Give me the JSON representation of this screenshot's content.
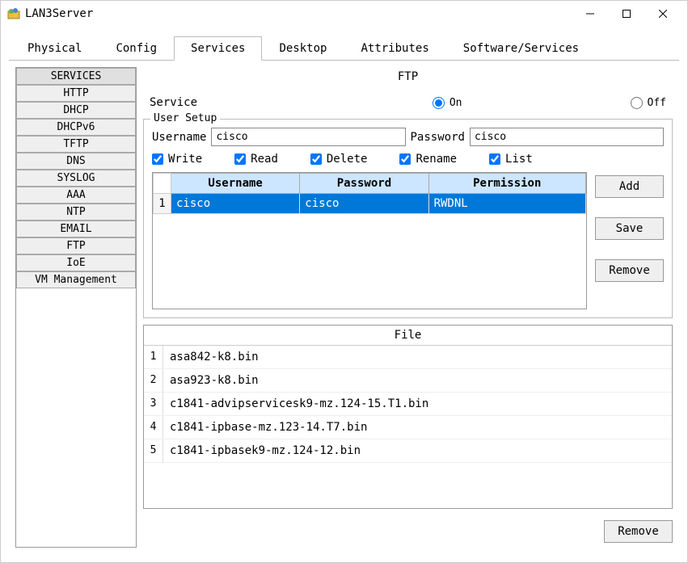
{
  "window": {
    "title": "LAN3Server"
  },
  "tabs": [
    {
      "label": "Physical"
    },
    {
      "label": "Config"
    },
    {
      "label": "Services"
    },
    {
      "label": "Desktop"
    },
    {
      "label": "Attributes"
    },
    {
      "label": "Software/Services"
    }
  ],
  "active_tab": 2,
  "sidebar": {
    "header": "SERVICES",
    "items": [
      "HTTP",
      "DHCP",
      "DHCPv6",
      "TFTP",
      "DNS",
      "SYSLOG",
      "AAA",
      "NTP",
      "EMAIL",
      "FTP",
      "IoE",
      "VM Management"
    ]
  },
  "panel": {
    "title": "FTP",
    "service_label": "Service",
    "on_label": "On",
    "off_label": "Off",
    "service_on": true
  },
  "user_setup": {
    "legend": "User Setup",
    "username_label": "Username",
    "username_value": "cisco",
    "password_label": "Password",
    "password_value": "cisco",
    "perms": {
      "write": {
        "label": "Write",
        "checked": true
      },
      "read": {
        "label": "Read",
        "checked": true
      },
      "delete": {
        "label": "Delete",
        "checked": true
      },
      "rename": {
        "label": "Rename",
        "checked": true
      },
      "list": {
        "label": "List",
        "checked": true
      }
    },
    "table": {
      "headers": {
        "username": "Username",
        "password": "Password",
        "permission": "Permission"
      },
      "rows": [
        {
          "num": "1",
          "username": "cisco",
          "password": "cisco",
          "permission": "RWDNL"
        }
      ]
    },
    "buttons": {
      "add": "Add",
      "save": "Save",
      "remove": "Remove"
    }
  },
  "files": {
    "header": "File",
    "rows": [
      {
        "num": "1",
        "name": "asa842-k8.bin"
      },
      {
        "num": "2",
        "name": "asa923-k8.bin"
      },
      {
        "num": "3",
        "name": "c1841-advipservicesk9-mz.124-15.T1.bin"
      },
      {
        "num": "4",
        "name": "c1841-ipbase-mz.123-14.T7.bin"
      },
      {
        "num": "5",
        "name": "c1841-ipbasek9-mz.124-12.bin"
      }
    ],
    "remove_label": "Remove"
  }
}
